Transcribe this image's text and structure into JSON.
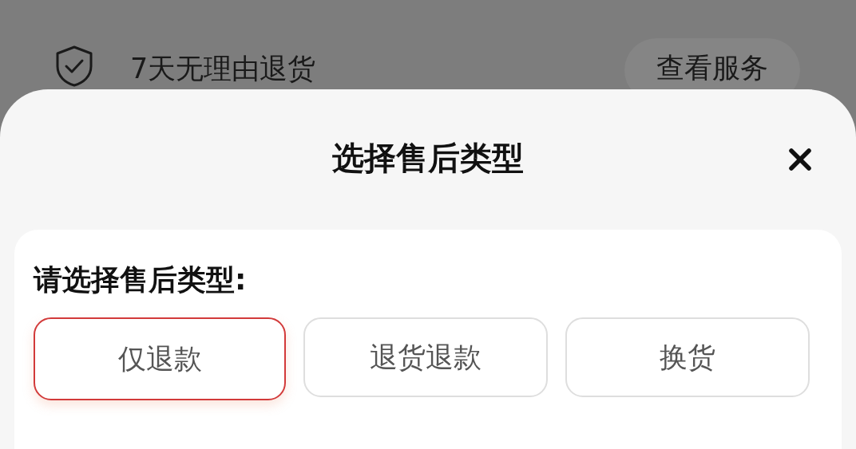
{
  "service_row": {
    "label": "7天无理由退货",
    "button": "查看服务"
  },
  "sheet": {
    "title": "选择售后类型",
    "prompt": "请选择售后类型:",
    "options": [
      {
        "label": "仅退款",
        "selected": true
      },
      {
        "label": "退货退款",
        "selected": false
      },
      {
        "label": "换货",
        "selected": false
      }
    ]
  }
}
